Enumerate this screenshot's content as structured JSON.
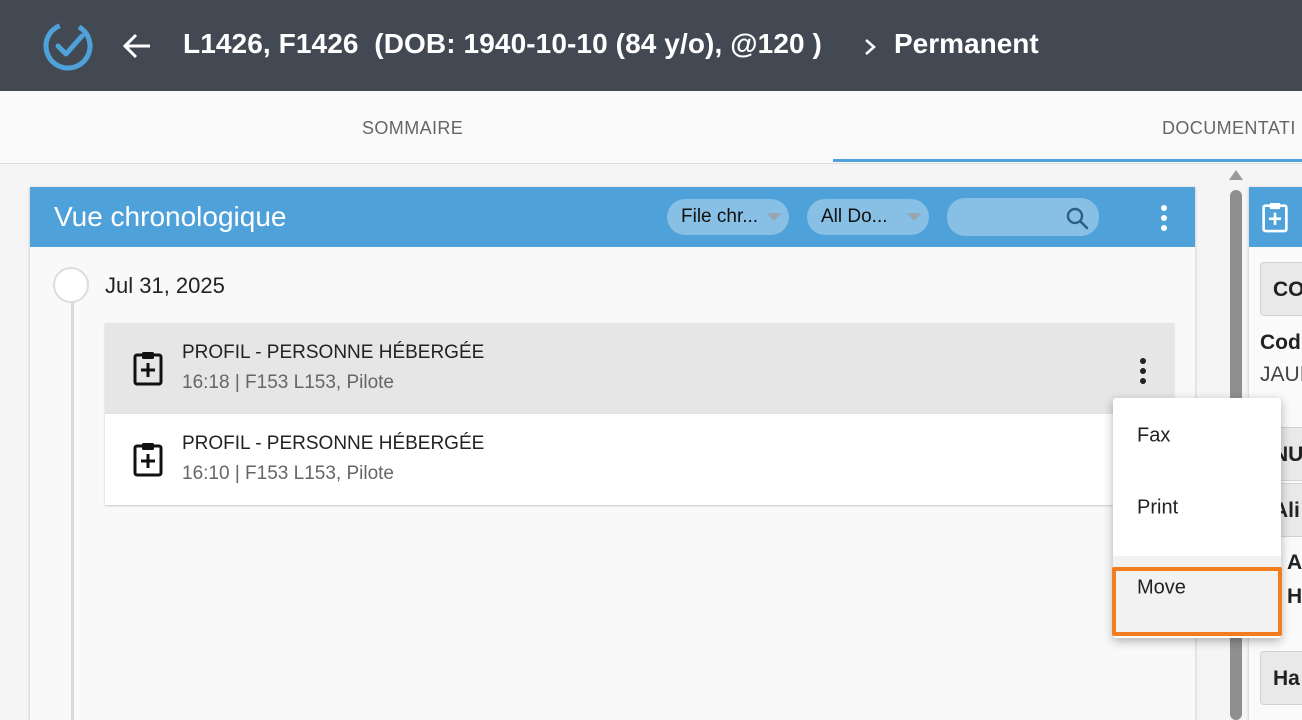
{
  "header": {
    "title": "L1426, F1426  (DOB: 1940-10-10 (84 y/o), @120 )",
    "breadcrumb_current": "Permanent"
  },
  "tabs": [
    {
      "label": "SOMMAIRE",
      "active": false
    },
    {
      "label": "DOCUMENTATI",
      "active": true
    }
  ],
  "panel": {
    "title": "Vue chronologique",
    "filter_file": "File chr...",
    "filter_all": "All Do...",
    "search_placeholder": ""
  },
  "timeline": {
    "date": "Jul 31, 2025",
    "entries": [
      {
        "title": "PROFIL - PERSONNE HÉBERGÉE",
        "meta": "16:18 | F153 L153, Pilote",
        "icon": "clipboard-plus-icon"
      },
      {
        "title": "PROFIL - PERSONNE HÉBERGÉE",
        "meta": "16:10 | F153 L153, Pilote",
        "icon": "clipboard-plus-icon"
      }
    ]
  },
  "context_menu": {
    "items": [
      "Fax",
      "Print",
      "Move"
    ],
    "highlighted": "Move"
  },
  "right_panel": {
    "button1": "CO",
    "label1": "Cod",
    "value1": "JAUI",
    "button2": "NU",
    "button3": "Ali",
    "text1": "A",
    "text2": "H",
    "button4": "Ha"
  },
  "colors": {
    "topbar": "#424953",
    "accent": "#4ea1d9",
    "highlight": "#f07e1c"
  }
}
